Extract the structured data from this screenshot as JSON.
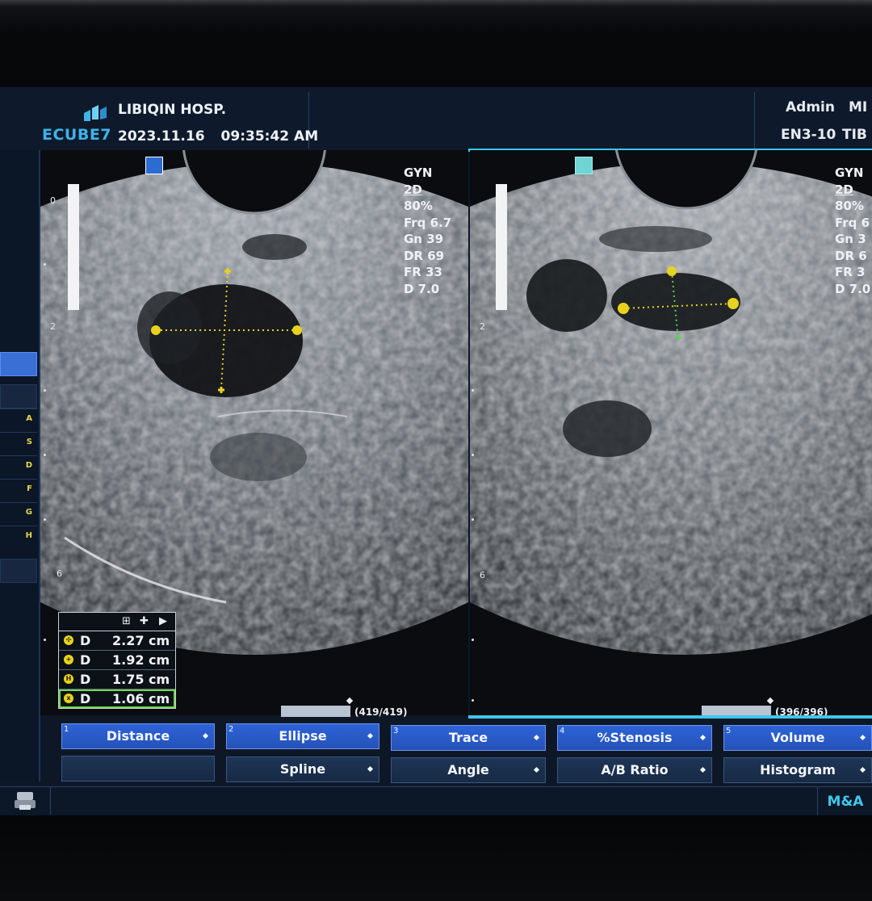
{
  "header": {
    "logo_text": "ECUBE7",
    "hospital": "LIBIQIN HOSP.",
    "date": "2023.11.16",
    "time": "09:35:42 AM",
    "user": "Admin",
    "user_suffix": "MI",
    "probe": "EN3-10",
    "preset_abbrev": "TIB"
  },
  "sidebar": {
    "letters": [
      "A",
      "S",
      "D",
      "F",
      "G",
      "H"
    ]
  },
  "left_image": {
    "preset": "GYN",
    "mode": "2D",
    "power": "80%",
    "freq": "Frq 6.7",
    "gain": "Gn 39",
    "dynamic_range": "DR 69",
    "frame_rate": "FR 33",
    "depth": "D 7.0",
    "depth_marks": [
      "0",
      "2",
      "6"
    ],
    "cine": "(419/419)"
  },
  "right_image": {
    "preset": "GYN",
    "mode": "2D",
    "power": "80%",
    "freq": "Frq 6",
    "gain": "Gn 3",
    "dynamic_range": "DR 6",
    "frame_rate": "FR 3",
    "depth": "D 7.0",
    "depth_marks": [
      "2",
      "6"
    ],
    "cine": "(396/396)"
  },
  "measurements": [
    {
      "label": "D",
      "value": "2.27 cm",
      "cursor": "cross-dot"
    },
    {
      "label": "D",
      "value": "1.92 cm",
      "cursor": "plus"
    },
    {
      "label": "D",
      "value": "1.75 cm",
      "cursor": "bar-h"
    },
    {
      "label": "D",
      "value": "1.06 cm",
      "cursor": "bar-x",
      "selected": true
    }
  ],
  "tools_row1": [
    {
      "num": "1",
      "label": "Distance"
    },
    {
      "num": "2",
      "label": "Ellipse"
    },
    {
      "num": "3",
      "label": "Trace"
    },
    {
      "num": "4",
      "label": "%Stenosis"
    },
    {
      "num": "5",
      "label": "Volume"
    }
  ],
  "tools_row2": [
    {
      "label": ""
    },
    {
      "label": "Spline"
    },
    {
      "label": "Angle"
    },
    {
      "label": "A/B Ratio"
    },
    {
      "label": "Histogram"
    }
  ],
  "status": {
    "mode_tab": "M&A"
  },
  "colors": {
    "accent_blue": "#2d63d8",
    "cyan": "#3ec6ec",
    "caliper_yellow": "#e8d21e",
    "selection_green": "#6ed84c"
  }
}
